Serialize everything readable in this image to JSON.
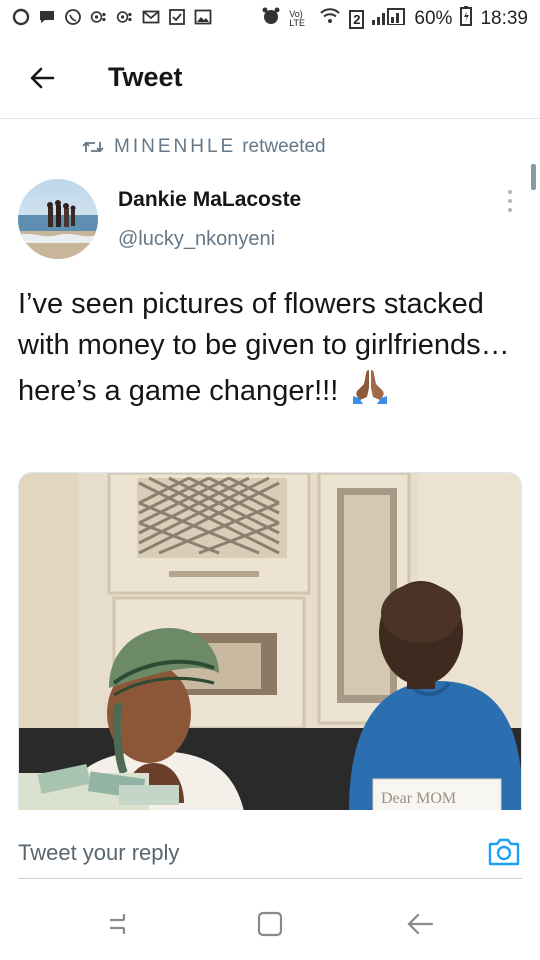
{
  "status_bar": {
    "battery_percent": "60%",
    "time": "18:39",
    "volte_label": "Vo) LTE",
    "sim_label": "2"
  },
  "app_bar": {
    "title": "Tweet"
  },
  "retweet": {
    "retweeter": "MINENHLE",
    "suffix": "retweeted"
  },
  "tweet": {
    "author_name": "Dankie MaLacoste",
    "author_handle": "@lucky_nkonyeni",
    "text": "I’ve seen pictures of flowers stacked with money to be given to girlfriends…here’s a game changer!!!",
    "emoji": "praying-hands",
    "media": {
      "sign_text": "Dear MOM"
    }
  },
  "reply": {
    "placeholder": "Tweet your reply"
  },
  "colors": {
    "accent": "#1da1f2",
    "secondary_text": "#657786",
    "divider": "#e1e8ed"
  },
  "icons": {
    "back": "arrow-left-icon",
    "retweet": "retweet-icon",
    "more": "more-vertical-icon",
    "camera": "camera-icon",
    "nav_recents": "recents-icon",
    "nav_home": "home-icon",
    "nav_back": "back-icon"
  }
}
